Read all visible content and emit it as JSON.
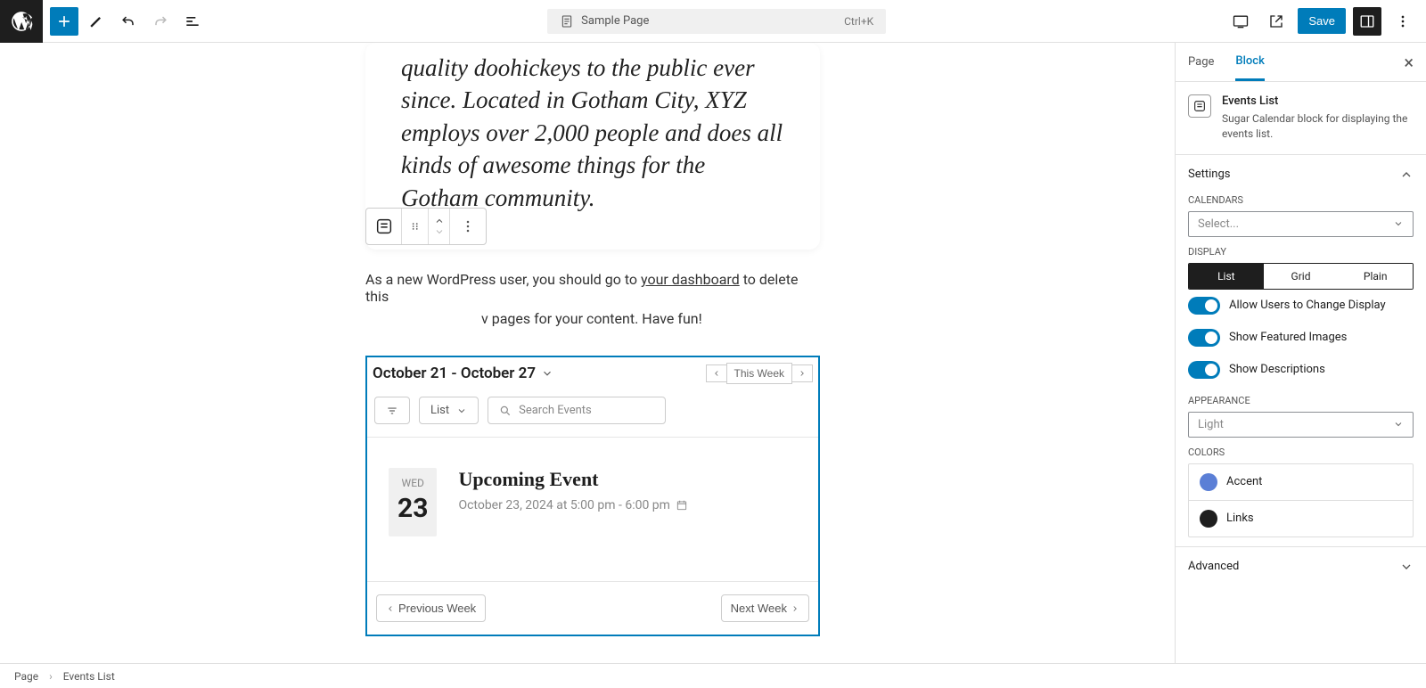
{
  "topbar": {
    "doc_title": "Sample Page",
    "shortcut": "Ctrl+K",
    "save": "Save"
  },
  "quote": "quality doohickeys to the public ever since. Located in Gotham City, XYZ employs over 2,000 people and does all kinds of awesome things for the Gotham community.",
  "body_text_1": "As a new WordPress user, you should go to ",
  "body_link": "your dashboard",
  "body_text_2": " to delete this",
  "body_text_3": "v pages for your content. Have fun!",
  "events": {
    "range": "October 21 - October 27",
    "this_week": "This Week",
    "view": "List",
    "search_placeholder": "Search Events",
    "event": {
      "day": "WED",
      "num": "23",
      "title": "Upcoming Event",
      "meta": "October 23, 2024 at 5:00 pm - 6:00 pm"
    },
    "prev": "Previous Week",
    "next": "Next Week"
  },
  "sidebar": {
    "tabs": {
      "page": "Page",
      "block": "Block"
    },
    "block_title": "Events List",
    "block_desc": "Sugar Calendar block for displaying the events list.",
    "settings": "Settings",
    "calendars_label": "CALENDARS",
    "calendars_select": "Select...",
    "display_label": "DISPLAY",
    "display_opts": {
      "list": "List",
      "grid": "Grid",
      "plain": "Plain"
    },
    "toggle1": "Allow Users to Change Display",
    "toggle2": "Show Featured Images",
    "toggle3": "Show Descriptions",
    "appearance_label": "APPEARANCE",
    "appearance_value": "Light",
    "colors_label": "COLORS",
    "color_accent": "Accent",
    "color_links": "Links",
    "advanced": "Advanced"
  },
  "breadcrumb": {
    "page": "Page",
    "block": "Events List"
  }
}
